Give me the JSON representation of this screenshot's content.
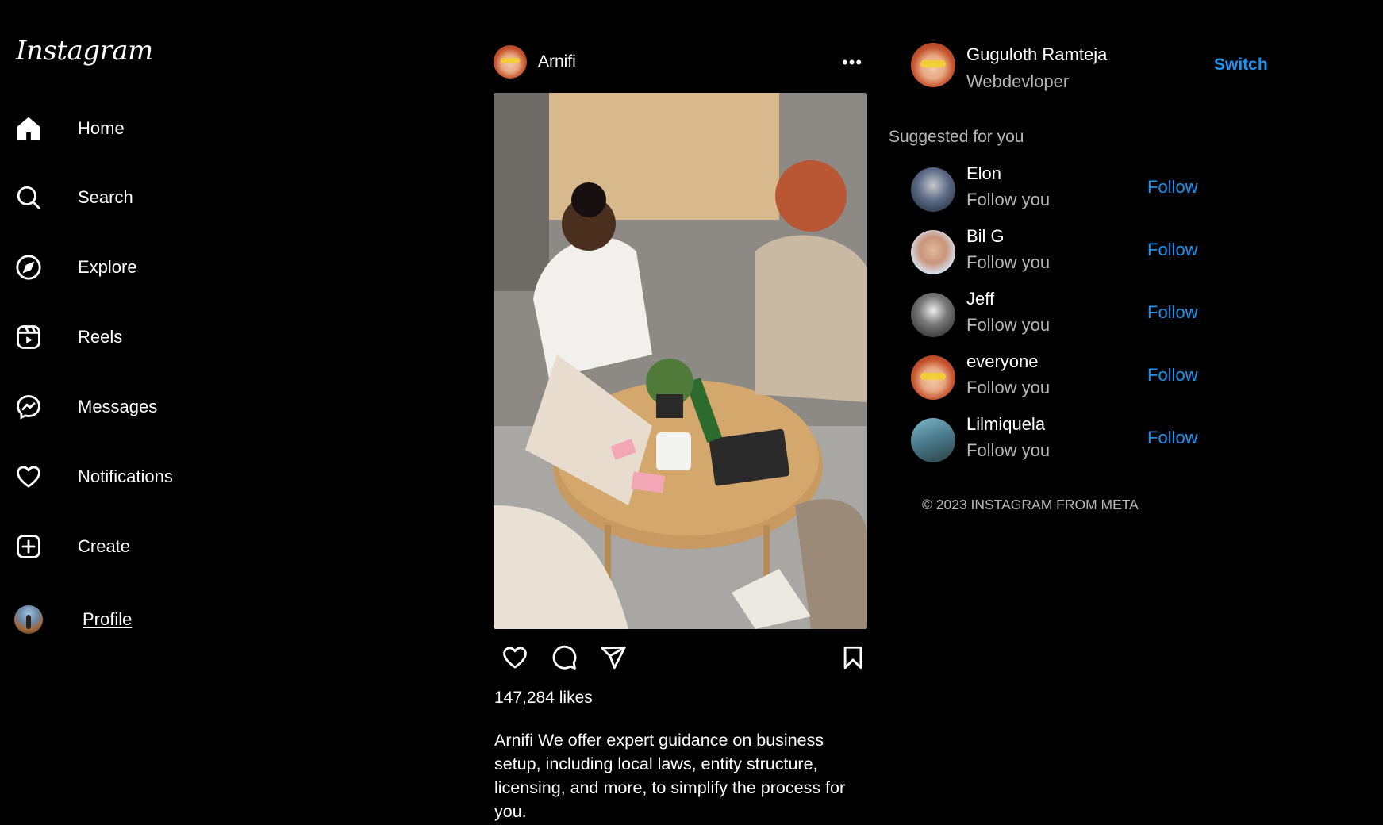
{
  "brand": {
    "logo_text": "Instagram"
  },
  "sidebar": {
    "items": [
      {
        "label": "Home",
        "icon": "home-icon"
      },
      {
        "label": "Search",
        "icon": "search-icon"
      },
      {
        "label": "Explore",
        "icon": "compass-icon"
      },
      {
        "label": "Reels",
        "icon": "reels-icon"
      },
      {
        "label": "Messages",
        "icon": "messenger-icon"
      },
      {
        "label": "Notifications",
        "icon": "heart-icon"
      },
      {
        "label": "Create",
        "icon": "plus-square-icon"
      },
      {
        "label": "Profile",
        "icon": "profile-avatar"
      }
    ]
  },
  "post": {
    "username": "Arnifi",
    "more_label": "•••",
    "image_alt": "photo",
    "likes": "147,284 likes",
    "caption": "Arnifi We offer expert guidance on business setup, including local laws, entity structure, licensing, and more, to simplify the process for you."
  },
  "me": {
    "name": "Guguloth Ramteja",
    "subtitle": "Webdevloper",
    "switch_label": "Switch"
  },
  "suggestions": {
    "title": "Suggested for you",
    "items": [
      {
        "name": "Elon",
        "status": "Follow you",
        "action": "Follow"
      },
      {
        "name": "Bil G",
        "status": "Follow you",
        "action": "Follow"
      },
      {
        "name": "Jeff",
        "status": "Follow you",
        "action": "Follow"
      },
      {
        "name": "everyone",
        "status": "Follow you",
        "action": "Follow"
      },
      {
        "name": "Lilmiquela",
        "status": "Follow you",
        "action": "Follow"
      }
    ]
  },
  "footer": {
    "text": "© 2023 INSTAGRAM FROM META"
  },
  "colors": {
    "background": "#000000",
    "link": "#1a94f0",
    "muted": "#b7b7b7"
  }
}
